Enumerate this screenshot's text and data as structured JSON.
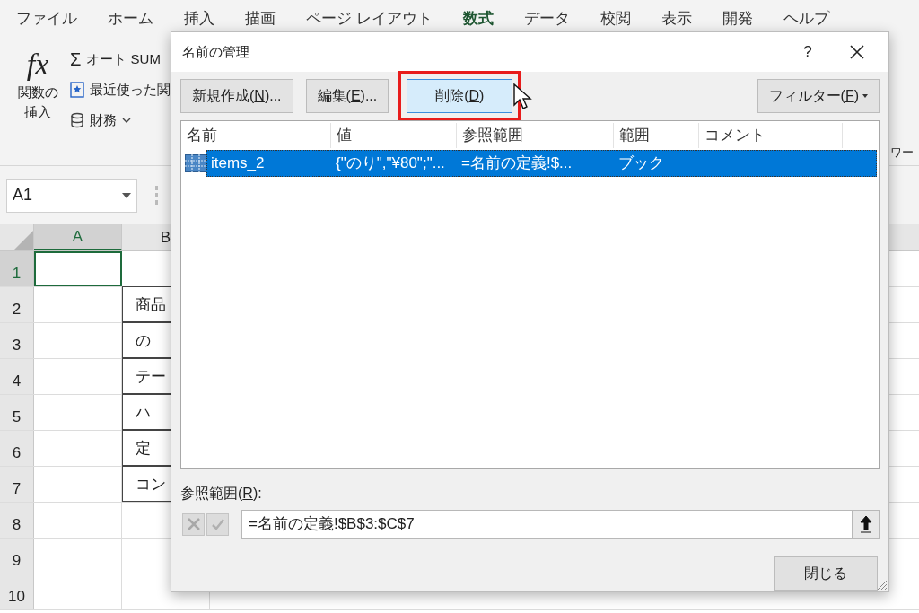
{
  "ribbon_tabs": [
    {
      "label": "ファイル",
      "selected": false
    },
    {
      "label": "ホーム",
      "selected": false
    },
    {
      "label": "挿入",
      "selected": false
    },
    {
      "label": "描画",
      "selected": false
    },
    {
      "label": "ページ レイアウト",
      "selected": false
    },
    {
      "label": "数式",
      "selected": true
    },
    {
      "label": "データ",
      "selected": false
    },
    {
      "label": "校閲",
      "selected": false
    },
    {
      "label": "表示",
      "selected": false
    },
    {
      "label": "開発",
      "selected": false
    },
    {
      "label": "ヘルプ",
      "selected": false
    }
  ],
  "ribbon": {
    "function_icon": "fx",
    "insert_function": "関数の挿入",
    "commands": [
      {
        "kind": "sum",
        "icon": "Σ",
        "label": "オート SUM"
      },
      {
        "kind": "recent",
        "label": "最近使った関"
      },
      {
        "kind": "finance",
        "label": "財務"
      }
    ],
    "right_label": "ワー"
  },
  "name_box": "A1",
  "columns": [
    "A",
    "B"
  ],
  "rows": [
    {
      "number": "1",
      "selected": true,
      "cell_b": null
    },
    {
      "number": "2",
      "selected": false,
      "cell_b": "商品"
    },
    {
      "number": "3",
      "selected": false,
      "cell_b": "の"
    },
    {
      "number": "4",
      "selected": false,
      "cell_b": "テー"
    },
    {
      "number": "5",
      "selected": false,
      "cell_b": "ハ"
    },
    {
      "number": "6",
      "selected": false,
      "cell_b": "定"
    },
    {
      "number": "7",
      "selected": false,
      "cell_b": "コン"
    },
    {
      "number": "8",
      "selected": false,
      "cell_b": null
    },
    {
      "number": "9",
      "selected": false,
      "cell_b": null
    },
    {
      "number": "10",
      "selected": false,
      "cell_b": null
    }
  ],
  "dialog": {
    "title": "名前の管理",
    "help": "?",
    "buttons": [
      {
        "before": "新規作成(",
        "key": "N",
        "after": ")...",
        "highlighted": false
      },
      {
        "before": "編集(",
        "key": "E",
        "after": ")...",
        "highlighted": false
      },
      {
        "before": "削除(",
        "key": "D",
        "after": ")",
        "highlighted": true
      }
    ],
    "filter": {
      "before": "フィルター(",
      "key": "F",
      "after": ")"
    },
    "columns": [
      "名前",
      "値",
      "参照範囲",
      "範囲",
      "コメント"
    ],
    "rows": [
      {
        "selected": true,
        "cells": [
          "items_2",
          "{\"のり\",\"¥80\";\"...",
          "=名前の定義!$...",
          "ブック",
          ""
        ]
      }
    ],
    "refers_label": {
      "before": "参照範囲(",
      "key": "R",
      "after": "):"
    },
    "refers_value": "=名前の定義!$B$3:$C$7",
    "close": "閉じる"
  }
}
